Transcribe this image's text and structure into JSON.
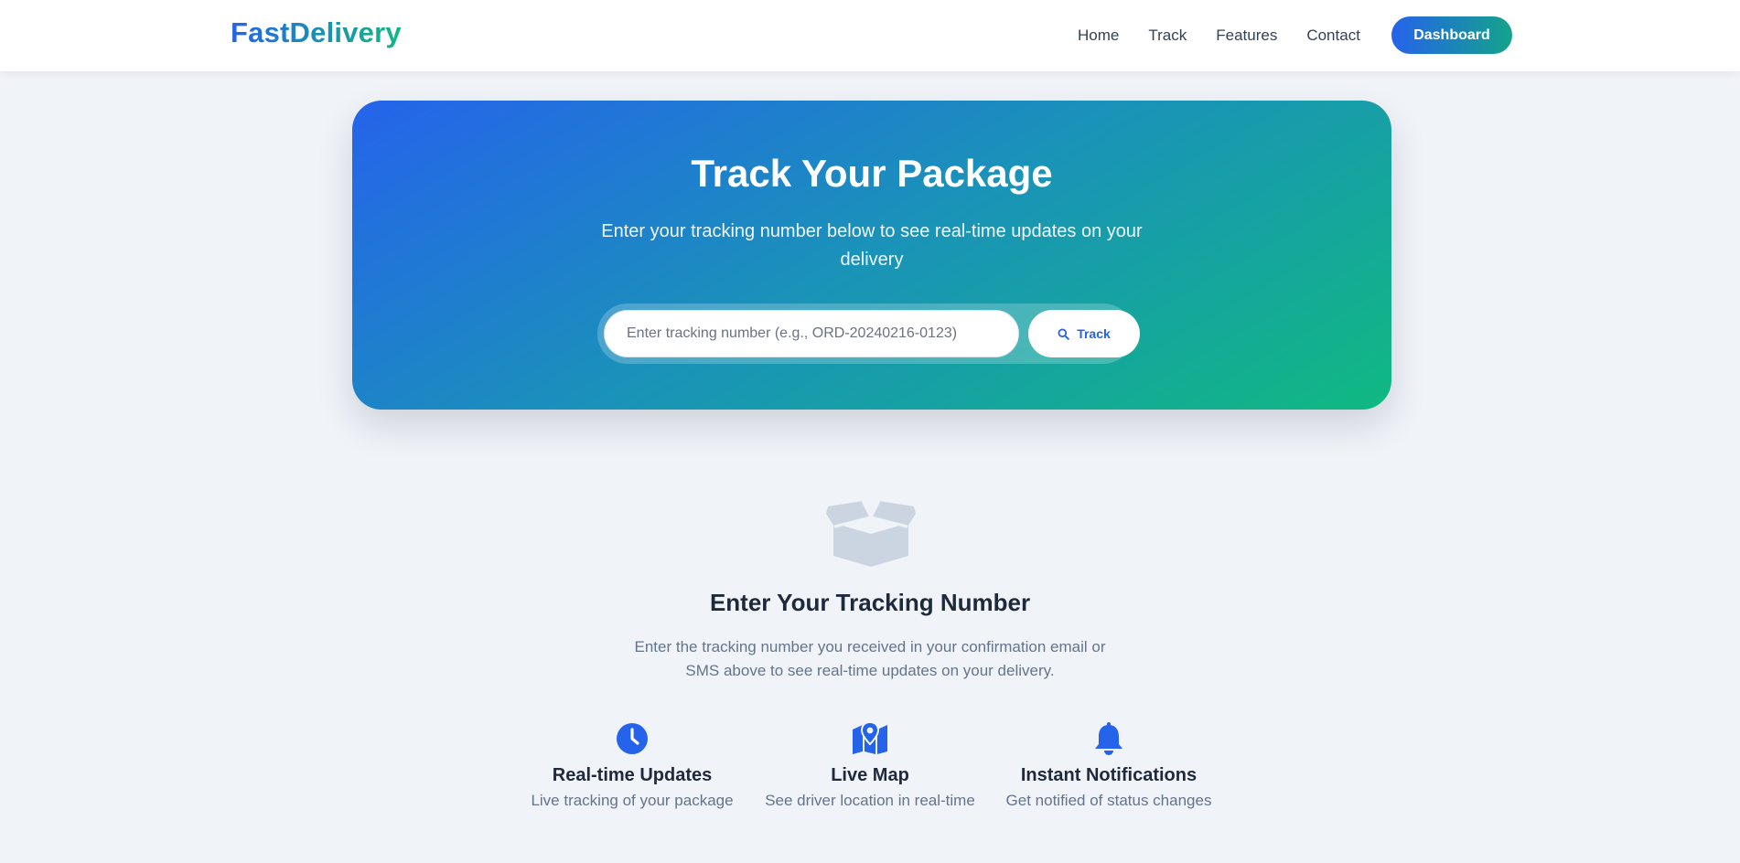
{
  "navbar": {
    "brand": "FastDelivery",
    "links": [
      "Home",
      "Track",
      "Features",
      "Contact"
    ],
    "dashboard_label": "Dashboard"
  },
  "hero": {
    "title": "Track Your Package",
    "subtitle": "Enter your tracking number below to see real-time updates on your delivery",
    "search": {
      "placeholder": "Enter tracking number (e.g., ORD-20240216-0123)",
      "value": ""
    },
    "track_label": "Track"
  },
  "empty_state": {
    "icon": "open-box-icon",
    "title": "Enter Your Tracking Number",
    "description": "Enter the tracking number you received in your confirmation email or SMS above to see real-time updates on your delivery."
  },
  "features": [
    {
      "icon": "clock-icon",
      "title": "Real-time Updates",
      "description": "Live tracking of your package"
    },
    {
      "icon": "map-pin-icon",
      "title": "Live Map",
      "description": "See driver location in real-time"
    },
    {
      "icon": "bell-icon",
      "title": "Instant Notifications",
      "description": "Get notified of status changes"
    }
  ],
  "colors": {
    "primary": "#2563eb",
    "accent": "#10b981",
    "background": "#f0f3f8",
    "muted_icon": "#cbd5e1"
  }
}
